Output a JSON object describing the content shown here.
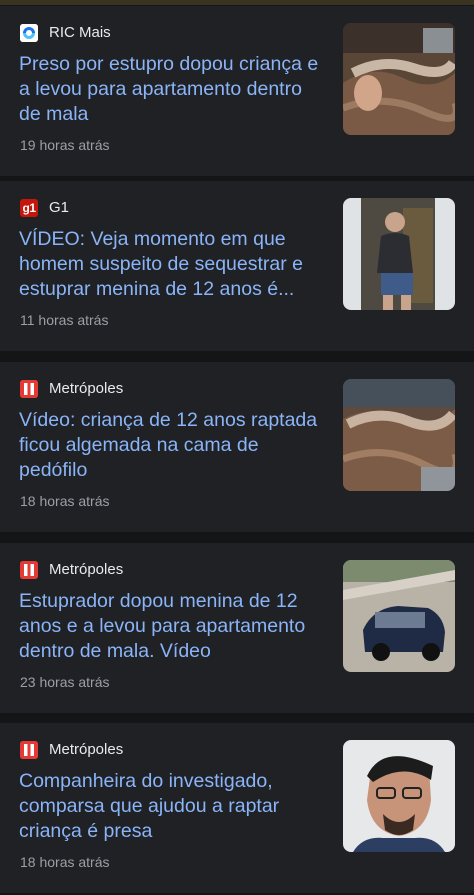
{
  "articles": [
    {
      "source": "RIC Mais",
      "source_icon": "ric-mais-logo-icon",
      "headline": "Preso por estupro dopou criança e a levou para apartamento dentro de mala",
      "time": "19 horas atrás"
    },
    {
      "source": "G1",
      "source_icon": "g1-logo-icon",
      "source_logo_text": "g1",
      "headline": "VÍDEO: Veja momento em que homem suspeito de sequestrar e estuprar menina de 12 anos é...",
      "time": "11 horas atrás"
    },
    {
      "source": "Metrópoles",
      "source_icon": "metropoles-logo-icon",
      "headline": "Vídeo: criança de 12 anos raptada ficou algemada na cama de pedófilo",
      "time": "18 horas atrás"
    },
    {
      "source": "Metrópoles",
      "source_icon": "metropoles-logo-icon",
      "headline": "Estuprador dopou menina de 12 anos e a levou para apartamento dentro de mala. Vídeo",
      "time": "23 horas atrás"
    },
    {
      "source": "Metrópoles",
      "source_icon": "metropoles-logo-icon",
      "headline": "Companheira do investigado, comparsa que ajudou a raptar criança é presa",
      "time": "18 horas atrás"
    }
  ],
  "colors": {
    "background": "#141517",
    "card": "#202124",
    "headline": "#8ab4f8",
    "source_text": "#e8eaed",
    "time_text": "#9aa0a6",
    "metropoles_red": "#e53935",
    "g1_red": "#c4170c",
    "ric_blue": "#1a73e8"
  }
}
